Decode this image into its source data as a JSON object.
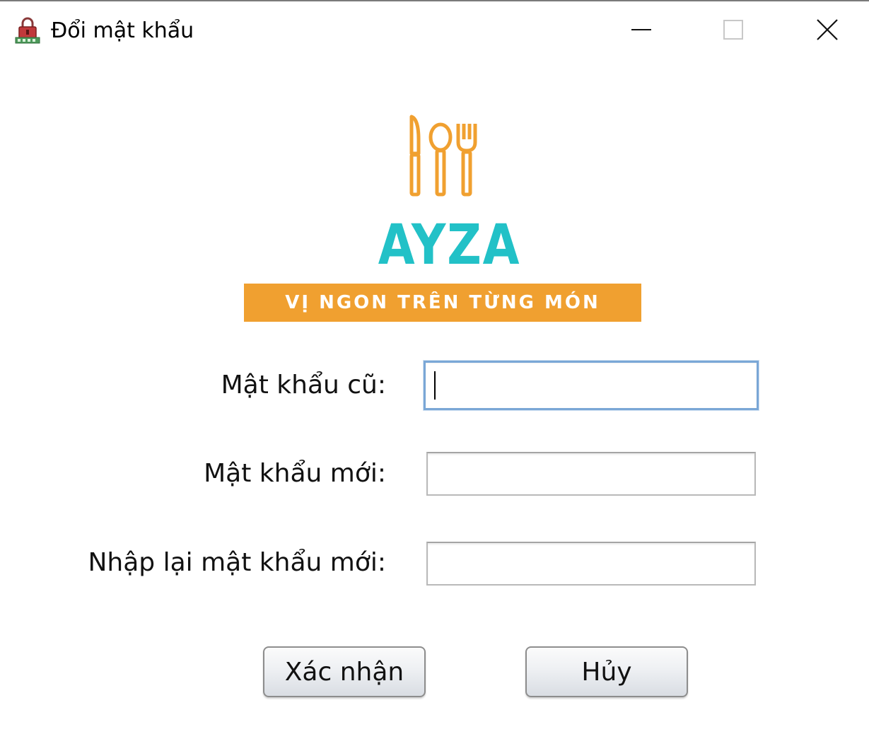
{
  "window": {
    "title": "Đổi mật khẩu",
    "icon": "lock-icon",
    "controls": {
      "minimize": "minimize-icon",
      "maximize": "maximize-icon",
      "close": "close-icon"
    }
  },
  "logo": {
    "icon": "cutlery-icon",
    "brand": "AYZA",
    "tagline": "VỊ NGON TRÊN TỪNG MÓN",
    "brand_color": "#22c1c7",
    "accent_color": "#f0a030"
  },
  "form": {
    "old_password": {
      "label": "Mật khẩu cũ:",
      "value": "",
      "focused": true
    },
    "new_password": {
      "label": "Mật khẩu mới:",
      "value": ""
    },
    "confirm_password": {
      "label": "Nhập lại mật khẩu mới:",
      "value": ""
    }
  },
  "buttons": {
    "confirm": "Xác nhận",
    "cancel": "Hủy"
  }
}
